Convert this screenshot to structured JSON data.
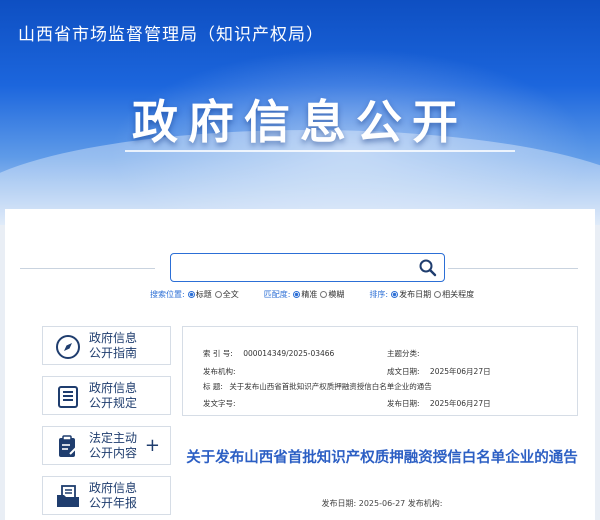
{
  "header": {
    "site_name": "山西省市场监督管理局（知识产权局）",
    "banner_title": "政府信息公开"
  },
  "search": {
    "value": "",
    "placeholder": "",
    "options": [
      {
        "label": "搜索位置:",
        "choices": [
          {
            "text": "标题",
            "selected": true
          },
          {
            "text": "全文",
            "selected": false
          }
        ]
      },
      {
        "label": "匹配度:",
        "choices": [
          {
            "text": "精准",
            "selected": true
          },
          {
            "text": "模糊",
            "selected": false
          }
        ]
      },
      {
        "label": "排序:",
        "choices": [
          {
            "text": "发布日期",
            "selected": true
          },
          {
            "text": "相关程度",
            "selected": false
          }
        ]
      }
    ]
  },
  "sidebar": {
    "items": [
      {
        "label_line1": "政府信息",
        "label_line2": "公开指南",
        "icon": "compass-icon"
      },
      {
        "label_line1": "政府信息",
        "label_line2": "公开规定",
        "icon": "list-document-icon"
      },
      {
        "label_line1": "法定主动",
        "label_line2": "公开内容",
        "icon": "clipboard-edit-icon",
        "expand": "+"
      },
      {
        "label_line1": "政府信息",
        "label_line2": "公开年报",
        "icon": "folder-document-icon"
      }
    ]
  },
  "info": {
    "index_label": "索 引 号:",
    "index_value": "000014349/2025-03466",
    "category_label": "主题分类:",
    "category_value": "",
    "org_label": "发布机构:",
    "org_value": "",
    "created_label": "成文日期:",
    "created_value": "2025年06月27日",
    "title_label": "标      题:",
    "title_value": "关于发布山西省首批知识产权质押融资授信白名单企业的通告",
    "docno_label": "发文字号:",
    "docno_value": "",
    "published_label": "发布日期:",
    "published_value": "2025年06月27日"
  },
  "notice": {
    "title": "关于发布山西省首批知识产权质押融资授信白名单企业的通告",
    "meta": "发布日期: 2025-06-27 发布机构:"
  },
  "colors": {
    "brand_blue": "#1c66dd",
    "link_blue": "#2c5fc4",
    "sidebar_text": "#1f3d6e"
  }
}
